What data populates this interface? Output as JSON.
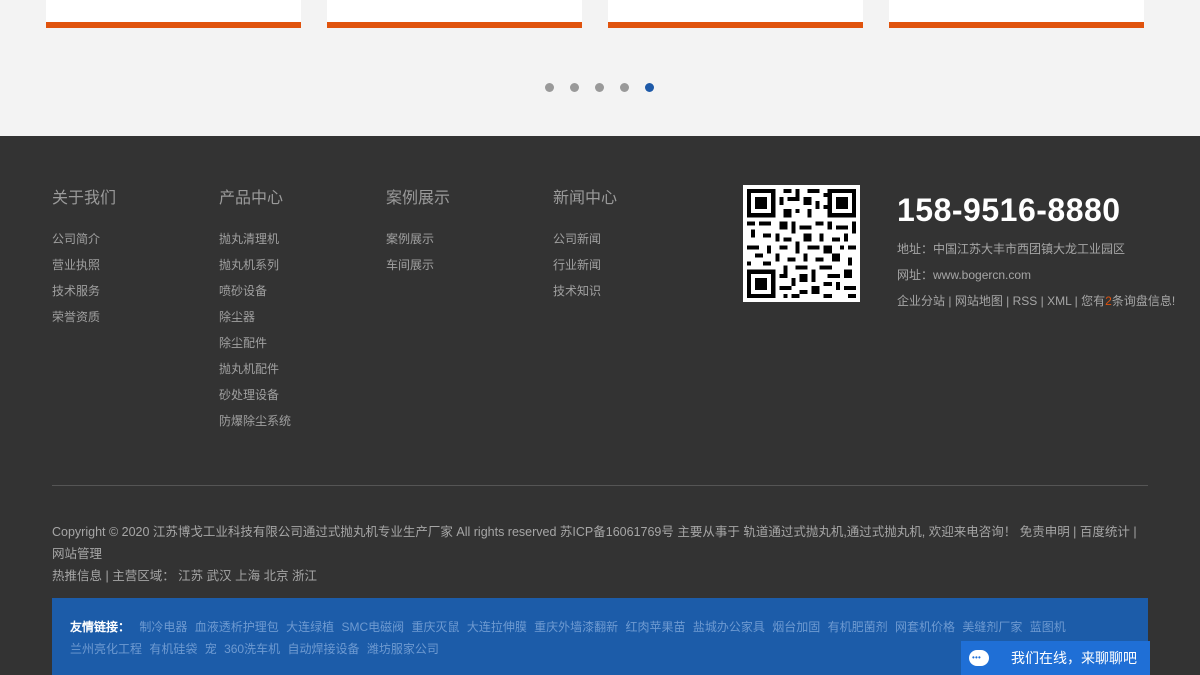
{
  "carousel": {
    "dots": 5,
    "active_index": 4
  },
  "footer": {
    "columns": [
      {
        "title": "关于我们",
        "links": [
          "公司简介",
          "营业执照",
          "技术服务",
          "荣誉资质"
        ]
      },
      {
        "title": "产品中心",
        "links": [
          "抛丸清理机",
          "抛丸机系列",
          "喷砂设备",
          "除尘器",
          "除尘配件",
          "抛丸机配件",
          "砂处理设备",
          "防爆除尘系统"
        ]
      },
      {
        "title": "案例展示",
        "links": [
          "案例展示",
          "车间展示"
        ]
      },
      {
        "title": "新闻中心",
        "links": [
          "公司新闻",
          "行业新闻",
          "技术知识"
        ]
      }
    ],
    "contact": {
      "phone": "158-9516-8880",
      "address": "地址：中国江苏大丰市西团镇大龙工业园区",
      "website": "网址：www.bogercn.com",
      "quick_links": [
        "企业分站",
        "网站地图",
        "RSS",
        "XML"
      ],
      "notice_prefix": "您有",
      "notice_count": "2",
      "notice_suffix": "条询盘信息!"
    },
    "copyright_line1": "Copyright © 2020 江苏博戈工业科技有限公司通过式抛丸机专业生产厂家 All rights reserved 苏ICP备16061769号 主要从事于 轨道通过式抛丸机,通过式抛丸机, 欢迎来电咨询！ 免责申明 | 百度统计 | 网站管理",
    "copyright_line2": "热推信息 | 主营区域： 江苏 武汉 上海 北京 浙江",
    "friend_links_label": "友情链接：",
    "friend_links": [
      "制冷电器",
      "血液透析护理包",
      "大连绿植",
      "SMC电磁阀",
      "重庆灭鼠",
      "大连拉伸膜",
      "重庆外墙漆翻新",
      "红肉苹果苗",
      "盐城办公家具",
      "烟台加固",
      "有机肥菌剂",
      "网套机价格",
      "美缝剂厂家",
      "蓝图机",
      "兰州亮化工程",
      "有机硅袋",
      "宠",
      "360洗车机",
      "自动焊接设备",
      "潍坊服家公司"
    ],
    "chat_label": "我们在线，来聊聊吧"
  }
}
